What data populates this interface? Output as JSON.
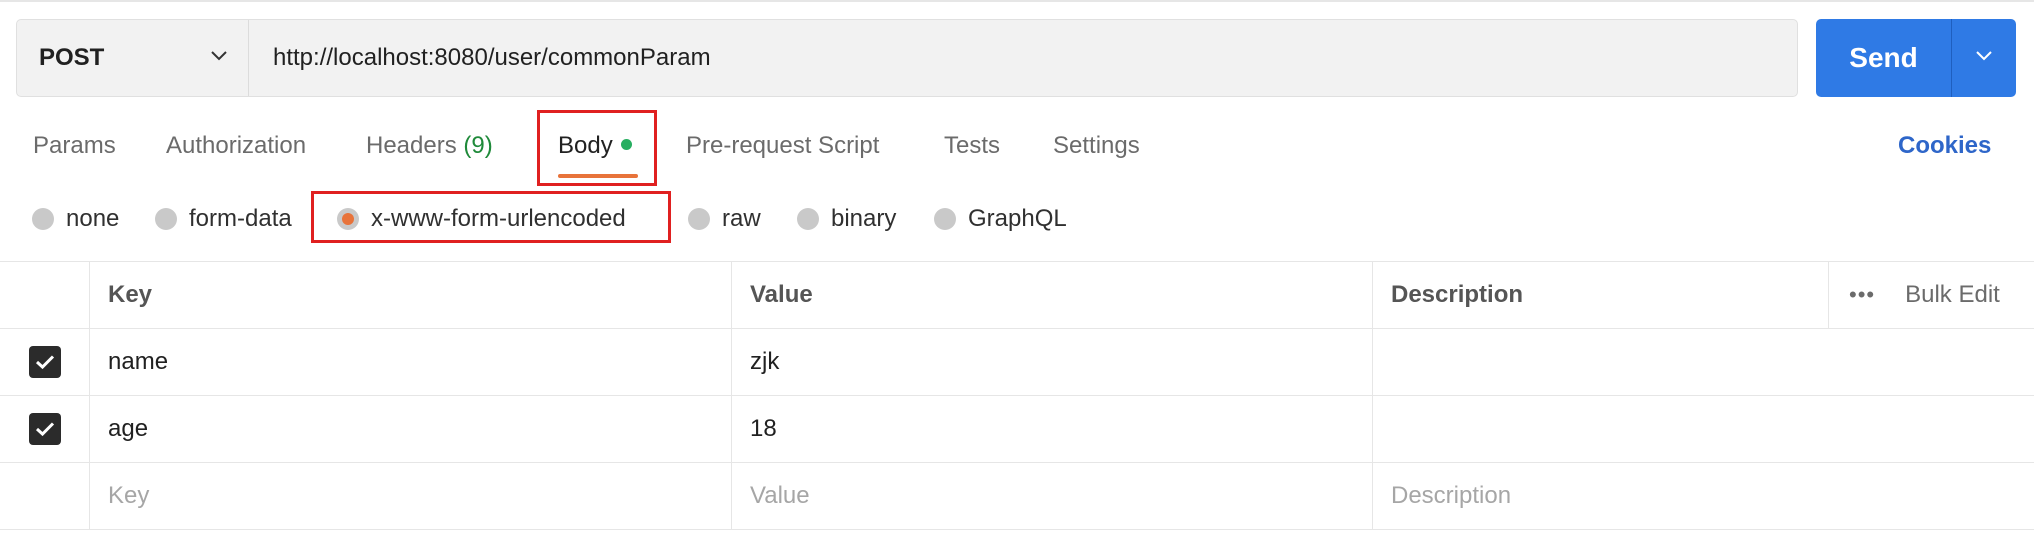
{
  "request": {
    "method": "POST",
    "url": "http://localhost:8080/user/commonParam",
    "send_label": "Send"
  },
  "tabs": {
    "params": "Params",
    "authorization": "Authorization",
    "headers": "Headers",
    "headers_count": "(9)",
    "body": "Body",
    "prerequest": "Pre-request Script",
    "tests": "Tests",
    "settings": "Settings",
    "cookies": "Cookies"
  },
  "body_types": {
    "none": "none",
    "form_data": "form-data",
    "urlencoded": "x-www-form-urlencoded",
    "raw": "raw",
    "binary": "binary",
    "graphql": "GraphQL",
    "selected": "x-www-form-urlencoded"
  },
  "table": {
    "headers": {
      "key": "Key",
      "value": "Value",
      "description": "Description",
      "bulk_edit": "Bulk Edit"
    },
    "rows": [
      {
        "checked": true,
        "key": "name",
        "value": "zjk",
        "description": ""
      },
      {
        "checked": true,
        "key": "age",
        "value": "18",
        "description": ""
      }
    ],
    "placeholders": {
      "key": "Key",
      "value": "Value",
      "description": "Description"
    }
  },
  "colors": {
    "send": "#2f7ae5",
    "active_tab_underline": "#e8733a",
    "highlight_box": "#e02020",
    "cookies_link": "#2e66c9"
  }
}
